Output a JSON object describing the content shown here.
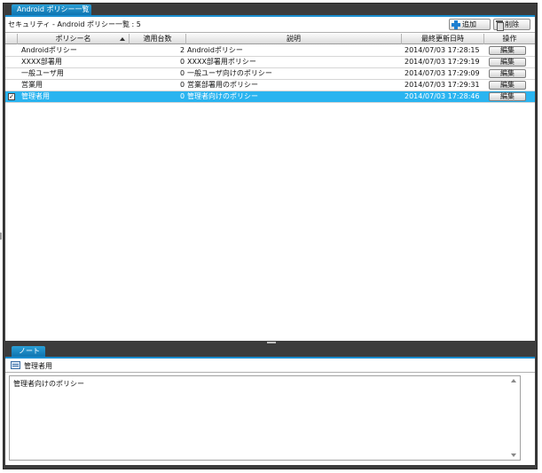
{
  "window": {
    "tab_title": "Android ポリシー一覧"
  },
  "toolbar": {
    "title": "セキュリティ - Android ポリシー一覧 : 5",
    "add_label": "追加",
    "delete_label": "削除"
  },
  "grid": {
    "columns": {
      "name": "ポリシー名",
      "count": "適用台数",
      "description": "説明",
      "updated": "最終更新日時",
      "action": "操作"
    },
    "edit_label": "編集",
    "check_mark": "✓",
    "rows": [
      {
        "name": "Androidポリシー",
        "count": "2",
        "description": "Androidポリシー",
        "updated": "2014/07/03 17:28:15",
        "selected": false
      },
      {
        "name": "XXXX部署用",
        "count": "0",
        "description": "XXXX部署用ポリシー",
        "updated": "2014/07/03 17:29:19",
        "selected": false
      },
      {
        "name": "一般ユーザ用",
        "count": "0",
        "description": "一般ユーザ向けのポリシー",
        "updated": "2014/07/03 17:29:09",
        "selected": false
      },
      {
        "name": "営業用",
        "count": "0",
        "description": "営業部署用のポリシー",
        "updated": "2014/07/03 17:29:31",
        "selected": false
      },
      {
        "name": "管理者用",
        "count": "0",
        "description": "管理者向けのポリシー",
        "updated": "2014/07/03 17:28:46",
        "selected": true
      }
    ]
  },
  "note": {
    "tab_label": "ノート",
    "header_title": "管理者用",
    "content": "管理者向けのポリシー"
  },
  "colors": {
    "accent": "#1a8ed0",
    "selected_row": "#2ab4f0",
    "frame": "#3c3c3c"
  }
}
